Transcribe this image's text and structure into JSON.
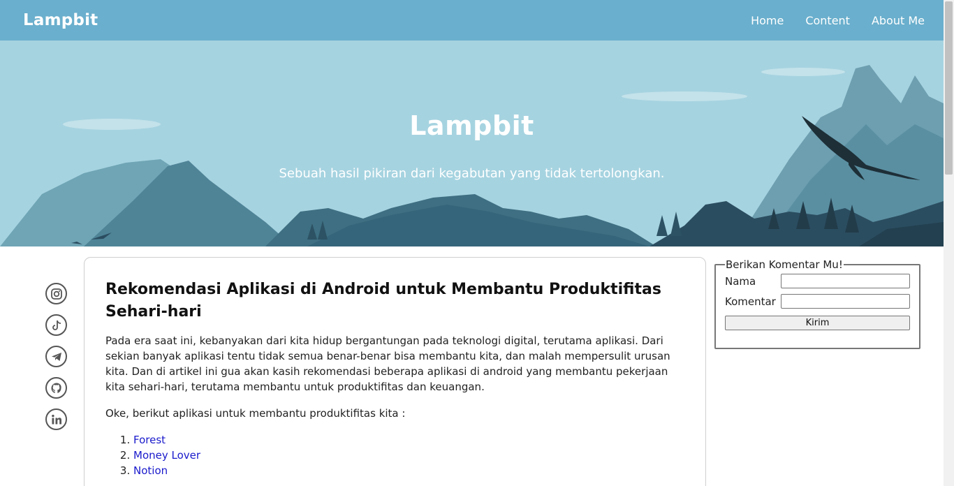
{
  "navbar": {
    "brand": "Lampbit",
    "links": [
      "Home",
      "Content",
      "About Me"
    ]
  },
  "hero": {
    "title": "Lampbit",
    "subtitle": "Sebuah hasil pikiran dari kegabutan yang tidak tertolongkan."
  },
  "social": {
    "icons": [
      "instagram-icon",
      "tiktok-icon",
      "telegram-icon",
      "github-icon",
      "linkedin-icon"
    ]
  },
  "article": {
    "title": "Rekomendasi Aplikasi di Android untuk Membantu Produktifitas Sehari-hari",
    "paragraph1": "Pada era saat ini, kebanyakan dari kita hidup bergantungan pada teknologi digital, terutama aplikasi. Dari sekian banyak aplikasi tentu tidak semua benar-benar bisa membantu kita, dan malah mempersulit urusan kita. Dan di artikel ini gua akan kasih rekomendasi beberapa aplikasi di android yang membantu pekerjaan kita sehari-hari, terutama membantu untuk produktifitas dan keuangan.",
    "paragraph2": "Oke, berikut aplikasi untuk membantu produktifitas kita :",
    "apps": [
      "Forest",
      "Money Lover",
      "Notion"
    ]
  },
  "comment_form": {
    "legend": "Berikan Komentar Mu!",
    "name_label": "Nama",
    "name_value": "",
    "comment_label": "Komentar",
    "comment_value": "",
    "submit_label": "Kirim"
  },
  "colors": {
    "navbar": "#6aafcd",
    "hero_sky": "#a6d3e0",
    "link": "#1a1acc"
  }
}
